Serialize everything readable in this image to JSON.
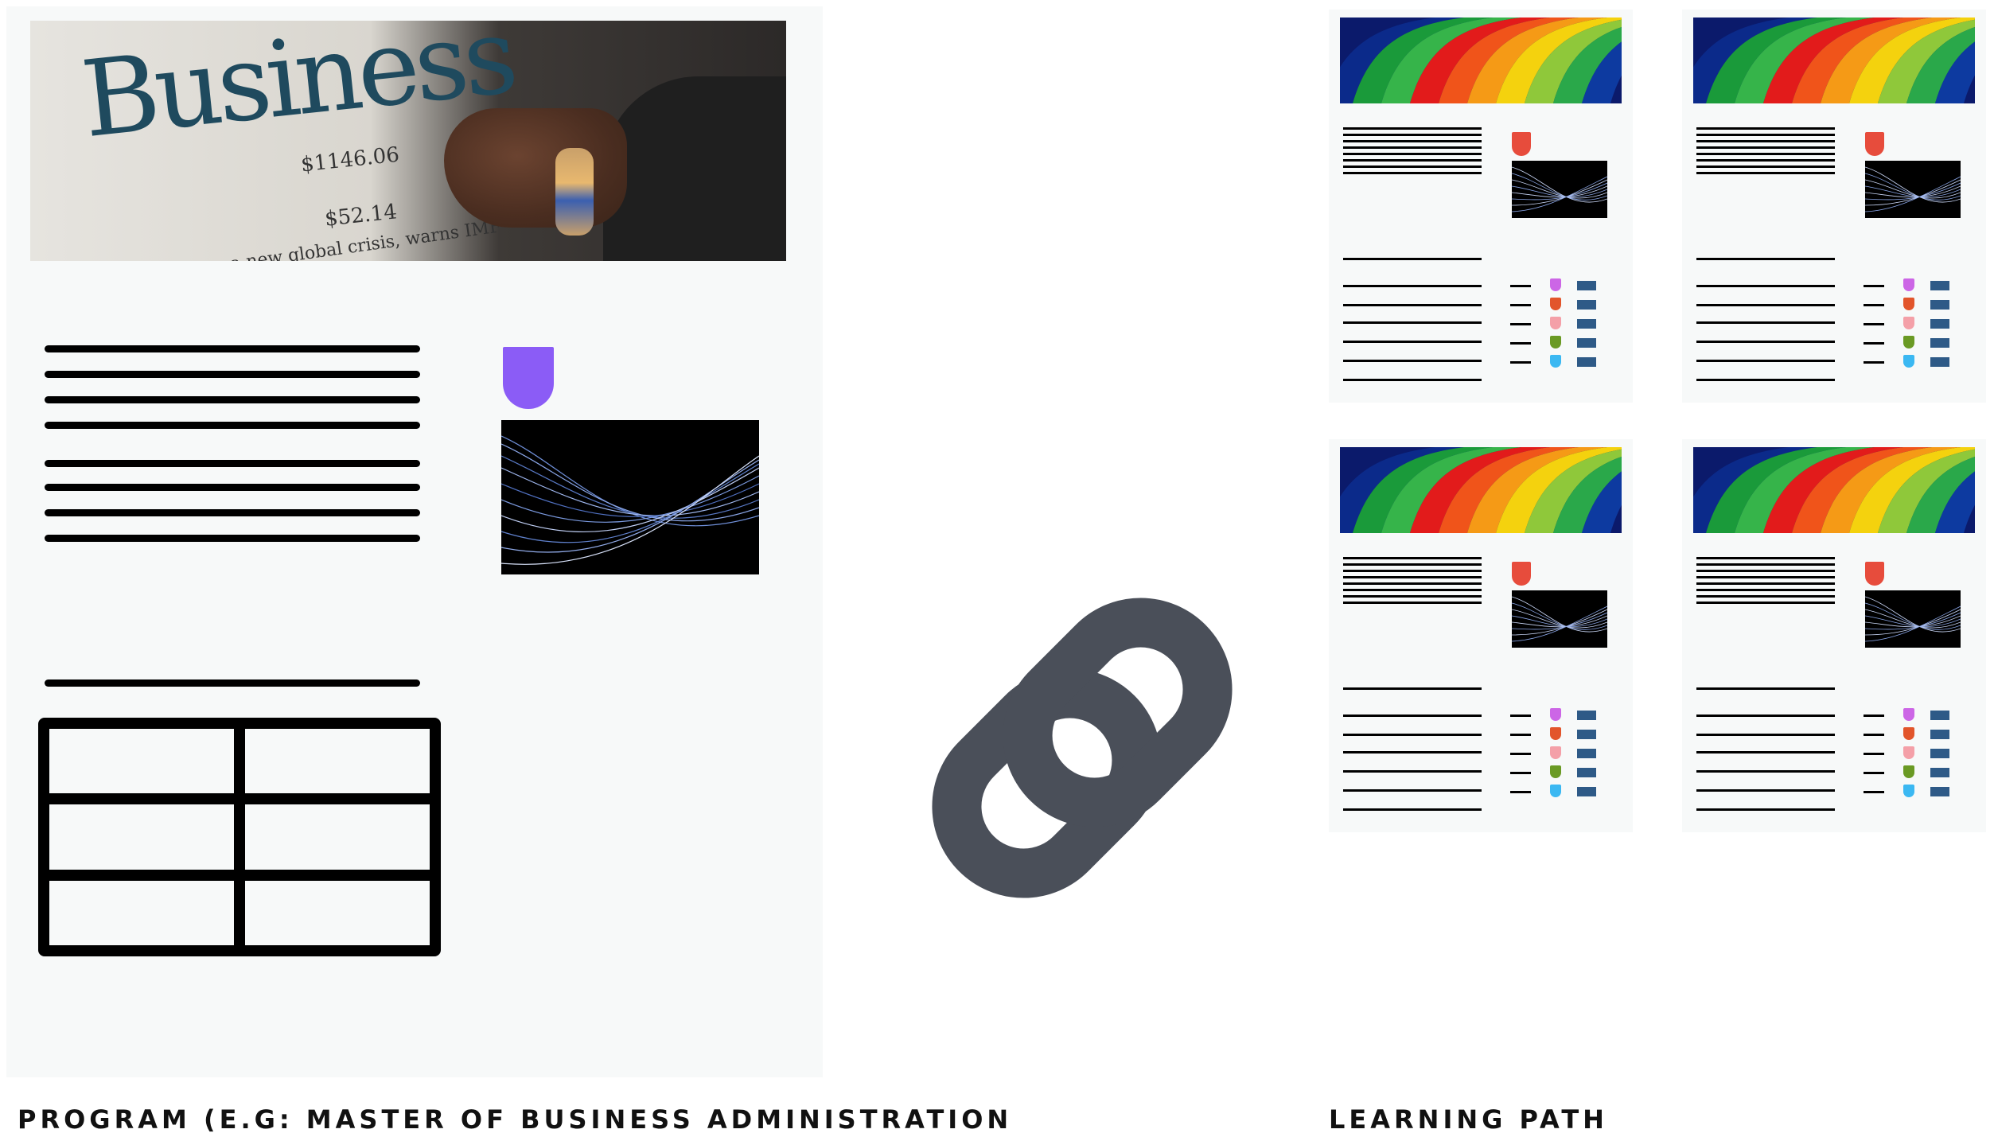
{
  "program": {
    "caption": "PROGRAM (E.G: MASTER OF BUSINESS ADMINISTRATION",
    "hero": {
      "word": "Business",
      "price_1": "$1146.06",
      "price_2": "$52.14",
      "headline": "a new global crisis, warns IMF"
    },
    "badge_color": "#8b5cf6",
    "text_line_count": 8,
    "table": {
      "rows": 3,
      "columns": 2
    }
  },
  "learning_path": {
    "caption": "LEARNING PATH",
    "page_count": 4,
    "badge_color": "#e74c3c",
    "dot_colors": [
      "#cc66e6",
      "#e2552b",
      "#f4a0a8",
      "#6a9a24",
      "#3bb8f2"
    ],
    "bar_color": "#2e5a87"
  },
  "link_icon": {
    "name": "link-icon",
    "color": "#4a4f59"
  }
}
